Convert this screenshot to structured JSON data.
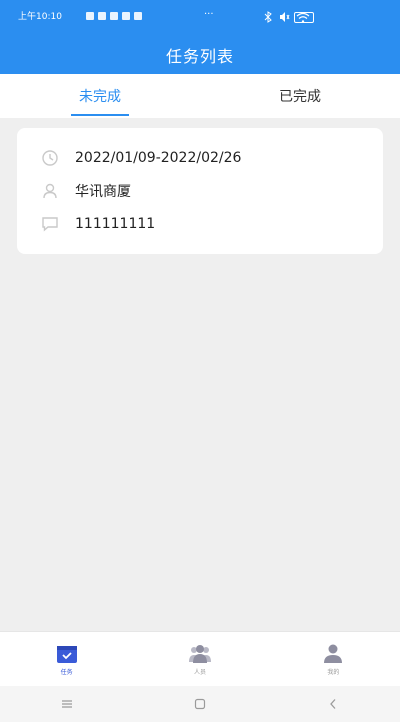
{
  "status_bar": {
    "time": "上午10:10"
  },
  "header": {
    "title": "任务列表"
  },
  "tabs": [
    {
      "label": "未完成",
      "active": true
    },
    {
      "label": "已完成",
      "active": false
    }
  ],
  "task_card": {
    "date_range": "2022/01/09-2022/02/26",
    "location": "华讯商厦",
    "note": "111111111"
  },
  "bottom_nav": [
    {
      "label": "任务",
      "icon": "calendar-check-icon",
      "active": true
    },
    {
      "label": "人员",
      "icon": "people-icon",
      "active": false
    },
    {
      "label": "我的",
      "icon": "person-icon",
      "active": false
    }
  ],
  "colors": {
    "primary": "#2b8ef0",
    "background": "#efefef",
    "nav_active": "#3a5bd8"
  }
}
